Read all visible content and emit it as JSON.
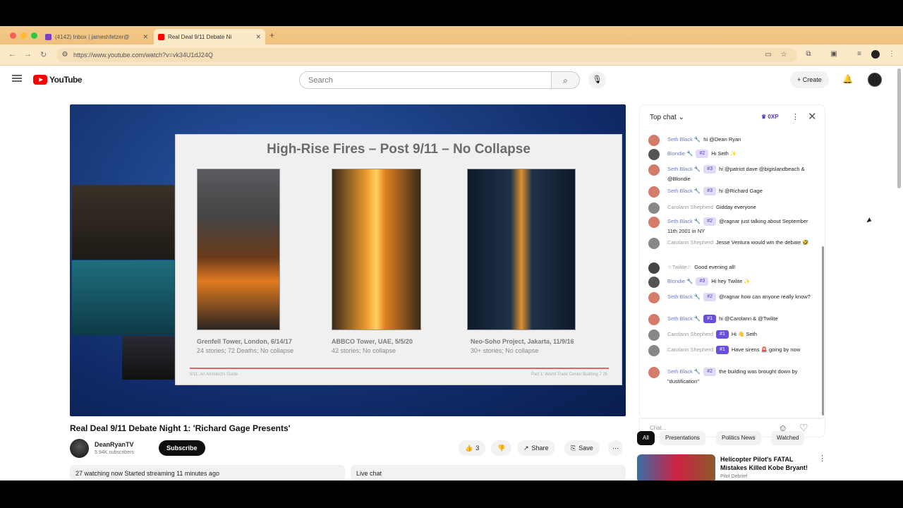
{
  "browser": {
    "tabs": [
      {
        "label": "(4142) Inbox | jameshfetzer@",
        "active": false
      },
      {
        "label": "Real Deal 9/11 Debate Ni",
        "active": true
      }
    ],
    "url": "https://www.youtube.com/watch?v=vk34U1dJ24Q"
  },
  "youtube": {
    "logo": "YouTube",
    "search_placeholder": "Search",
    "create_label": "Create"
  },
  "video": {
    "slide": {
      "title": "High-Rise Fires – Post 9/11 – No Collapse",
      "photos": [
        {
          "caption_title": "Grenfell Tower, London, 6/14/17",
          "caption_detail": "24 stories; 72 Deaths; No collapse"
        },
        {
          "caption_title": "ABBCO Tower, UAE, 5/5/20",
          "caption_detail": "42 stories; No collapse"
        },
        {
          "caption_title": "Neo-Soho Project, Jakarta, 11/9/16",
          "caption_detail": "30+ stories; No collapse"
        }
      ],
      "footer_left": "9/11: An Architect's Guide",
      "footer_right": "Part 1: World Trade Center Building 7   26"
    },
    "title": "Real Deal 9/11 Debate Night 1: 'Richard Gage Presents'",
    "channel": "DeanRyanTV",
    "subscribers": "5.94K subscribers",
    "subscribe_label": "Subscribe",
    "likes": "3",
    "share_label": "Share",
    "save_label": "Save",
    "watching": "27 watching now  Started streaming 11 minutes ago",
    "live_chat_label": "Live chat"
  },
  "chat": {
    "header": "Top chat",
    "xp": "0XP",
    "input_placeholder": "Chat...",
    "messages": [
      {
        "name": "Seth Black 🔧",
        "badge": "",
        "text": "hi @Dean Ryan",
        "gray": false,
        "color": "#d47b6a"
      },
      {
        "name": "Blondie 🔧",
        "badge": "#2",
        "text": "Hi Seth ✨",
        "gray": false,
        "color": "#555"
      },
      {
        "name": "Seth Black 🔧",
        "badge": "#3",
        "text": "hi @patriot dave @bigislandbeach & @Blondie",
        "gray": false,
        "color": "#d47b6a"
      },
      {
        "name": "Seth Black 🔧",
        "badge": "#3",
        "text": "hi @Richard Gage",
        "gray": false,
        "color": "#d47b6a"
      },
      {
        "name": "Carolann Shepherd",
        "badge": "",
        "text": "Gidday everyone",
        "gray": true,
        "color": "#888"
      },
      {
        "name": "Seth Black 🔧",
        "badge": "#2",
        "text": "@ragnar just talking about September 11th 2001 in NY",
        "gray": false,
        "color": "#d47b6a"
      },
      {
        "name": "Carolann Shepherd",
        "badge": "",
        "text": "Jesse Ventura would win the debate 🤣",
        "gray": true,
        "color": "#888"
      },
      {
        "name": "☆Twilite☆",
        "badge": "",
        "text": "Good evening all!",
        "gray": true,
        "color": "#444"
      },
      {
        "name": "Blondie 🔧",
        "badge": "#3",
        "text": "Hi hey Twilite ✨",
        "gray": false,
        "color": "#555"
      },
      {
        "name": "Seth Black 🔧",
        "badge": "#2",
        "text": "@ragnar how can anyone really know?",
        "gray": false,
        "color": "#d47b6a"
      },
      {
        "name": "Seth Black 🔧",
        "badge": "#1",
        "text": "hi @Carolann & @Twilite",
        "gray": false,
        "color": "#d47b6a",
        "strong": true
      },
      {
        "name": "Carolann Shepherd",
        "badge": "#1",
        "text": "Hi 👋 Seth",
        "gray": true,
        "color": "#888",
        "strong": true
      },
      {
        "name": "Carolann Shepherd",
        "badge": "#1",
        "text": "Have sirens 🚨 going by now",
        "gray": true,
        "color": "#888",
        "strong": true
      },
      {
        "name": "Seth Black 🔧",
        "badge": "#2",
        "text": "the building was brought down by \"dustification\"",
        "gray": false,
        "color": "#d47b6a"
      }
    ]
  },
  "chips": [
    "All",
    "Presentations",
    "Politics News",
    "Watched"
  ],
  "recommendation": {
    "title": "Helicopter Pilot's FATAL Mistakes Killed Kobe Bryant!",
    "channel": "Pilot Debrief"
  }
}
